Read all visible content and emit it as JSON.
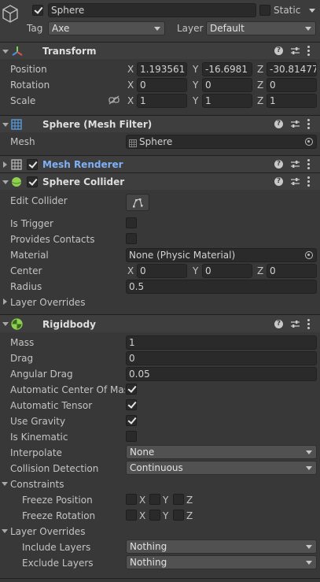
{
  "object": {
    "name": "Sphere",
    "static_label": "Static",
    "tag_label": "Tag",
    "tag_value": "Axe",
    "layer_label": "Layer",
    "layer_value": "Default",
    "active": true,
    "static": false
  },
  "transform": {
    "title": "Transform",
    "position_label": "Position",
    "rotation_label": "Rotation",
    "scale_label": "Scale",
    "axis_x": "X",
    "axis_y": "Y",
    "axis_z": "Z",
    "position": {
      "x": "1.193561",
      "y": "-16.6981",
      "z": "-30.81477"
    },
    "rotation": {
      "x": "0",
      "y": "0",
      "z": "0"
    },
    "scale": {
      "x": "1",
      "y": "1",
      "z": "1"
    }
  },
  "mesh_filter": {
    "title": "Sphere (Mesh Filter)",
    "mesh_label": "Mesh",
    "mesh_value": "Sphere"
  },
  "mesh_renderer": {
    "title": "Mesh Renderer",
    "enabled": true
  },
  "sphere_collider": {
    "title": "Sphere Collider",
    "enabled": true,
    "edit_collider_label": "Edit Collider",
    "is_trigger_label": "Is Trigger",
    "is_trigger": false,
    "provides_contacts_label": "Provides Contacts",
    "provides_contacts": false,
    "material_label": "Material",
    "material_value": "None (Physic Material)",
    "center_label": "Center",
    "center": {
      "x": "0",
      "y": "0",
      "z": "0"
    },
    "radius_label": "Radius",
    "radius_value": "0.5",
    "layer_overrides_label": "Layer Overrides"
  },
  "rigidbody": {
    "title": "Rigidbody",
    "mass_label": "Mass",
    "mass": "1",
    "drag_label": "Drag",
    "drag": "0",
    "angular_drag_label": "Angular Drag",
    "angular_drag": "0.05",
    "auto_center_label": "Automatic Center Of Mass",
    "auto_center": true,
    "auto_tensor_label": "Automatic Tensor",
    "auto_tensor": true,
    "use_gravity_label": "Use Gravity",
    "use_gravity": true,
    "is_kinematic_label": "Is Kinematic",
    "is_kinematic": false,
    "interpolate_label": "Interpolate",
    "interpolate": "None",
    "collision_label": "Collision Detection",
    "collision": "Continuous",
    "constraints_label": "Constraints",
    "freeze_position_label": "Freeze Position",
    "freeze_rotation_label": "Freeze Rotation",
    "layer_overrides_label": "Layer Overrides",
    "include_layers_label": "Include Layers",
    "include_layers": "Nothing",
    "exclude_layers_label": "Exclude Layers",
    "exclude_layers": "Nothing"
  },
  "colors": {
    "background": "#383838",
    "header": "#3e3e3e",
    "field": "#2a2a2a",
    "link_blue": "#7fb1f5",
    "collider_green": "#8fd14f"
  },
  "icons": {
    "object": "cube-outline-icon",
    "transform": "transform-axes-icon",
    "mesh_filter": "grid-icon",
    "mesh_renderer": "grid-icon",
    "sphere_collider": "sphere-collider-icon",
    "rigidbody": "rigidbody-icon",
    "help": "help-icon",
    "presets": "sliders-icon",
    "menu": "kebab-menu-icon",
    "target": "object-picker-icon",
    "link": "unlinked-chain-icon"
  }
}
